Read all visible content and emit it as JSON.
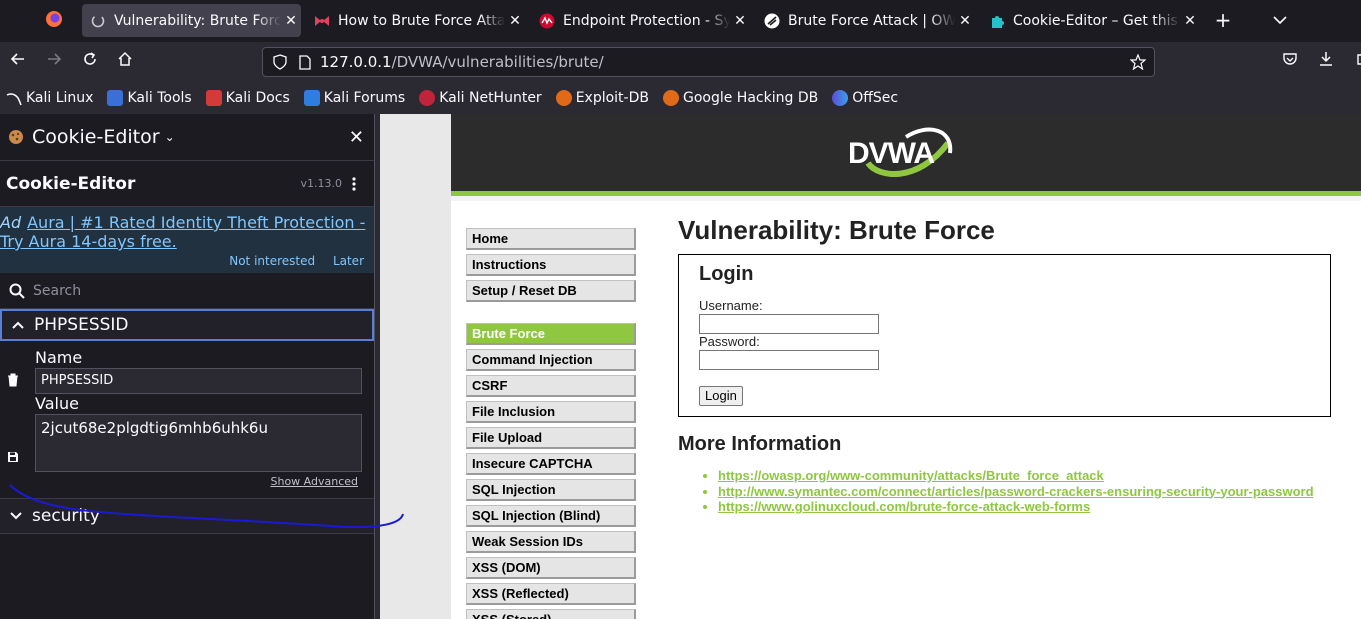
{
  "browser": {
    "tabs": [
      {
        "label": "Vulnerability: Brute Force",
        "active": true
      },
      {
        "label": "How to Brute Force Attack",
        "active": false
      },
      {
        "label": "Endpoint Protection - Sym",
        "active": false
      },
      {
        "label": "Brute Force Attack | OWA",
        "active": false
      },
      {
        "label": "Cookie-Editor – Get this E",
        "active": false
      }
    ],
    "url_host": "127.0.0.1",
    "url_path": "/DVWA/vulnerabilities/brute/",
    "bookmarks": [
      "Kali Linux",
      "Kali Tools",
      "Kali Docs",
      "Kali Forums",
      "Kali NetHunter",
      "Exploit-DB",
      "Google Hacking DB",
      "OffSec"
    ]
  },
  "sidebar": {
    "title": "Cookie-Editor",
    "app_name": "Cookie-Editor",
    "version": "v1.13.0",
    "ad_tag": "Ad",
    "ad_text": "Aura | #1 Rated Identity Theft Protection - Try Aura 14-days free.",
    "ad_not_interested": "Not interested",
    "ad_later": "Later",
    "search_placeholder": "Search",
    "cookies": [
      {
        "name": "PHPSESSID",
        "expanded": true,
        "name_label": "Name",
        "name_value": "PHPSESSID",
        "value_label": "Value",
        "value": "2jcut68e2plgdtig6mhb6uhk6u",
        "show_advanced": "Show Advanced"
      },
      {
        "name": "security",
        "expanded": false
      }
    ]
  },
  "dvwa": {
    "logo": "DVWA",
    "menu": [
      {
        "label": "Home"
      },
      {
        "label": "Instructions"
      },
      {
        "label": "Setup / Reset DB"
      },
      {
        "label": "Brute Force",
        "selected": true
      },
      {
        "label": "Command Injection"
      },
      {
        "label": "CSRF"
      },
      {
        "label": "File Inclusion"
      },
      {
        "label": "File Upload"
      },
      {
        "label": "Insecure CAPTCHA"
      },
      {
        "label": "SQL Injection"
      },
      {
        "label": "SQL Injection (Blind)"
      },
      {
        "label": "Weak Session IDs"
      },
      {
        "label": "XSS (DOM)"
      },
      {
        "label": "XSS (Reflected)"
      },
      {
        "label": "XSS (Stored)"
      }
    ],
    "heading": "Vulnerability: Brute Force",
    "login": {
      "title": "Login",
      "username_label": "Username:",
      "password_label": "Password:",
      "button": "Login"
    },
    "more_info_title": "More Information",
    "links": [
      "https://owasp.org/www-community/attacks/Brute_force_attack",
      "http://www.symantec.com/connect/articles/password-crackers-ensuring-security-your-password",
      "https://www.golinuxcloud.com/brute-force-attack-web-forms"
    ]
  },
  "colors": {
    "accent_green": "#8fc740",
    "focus_blue": "#5b7fd6",
    "ad_link": "#7ec6ff"
  }
}
